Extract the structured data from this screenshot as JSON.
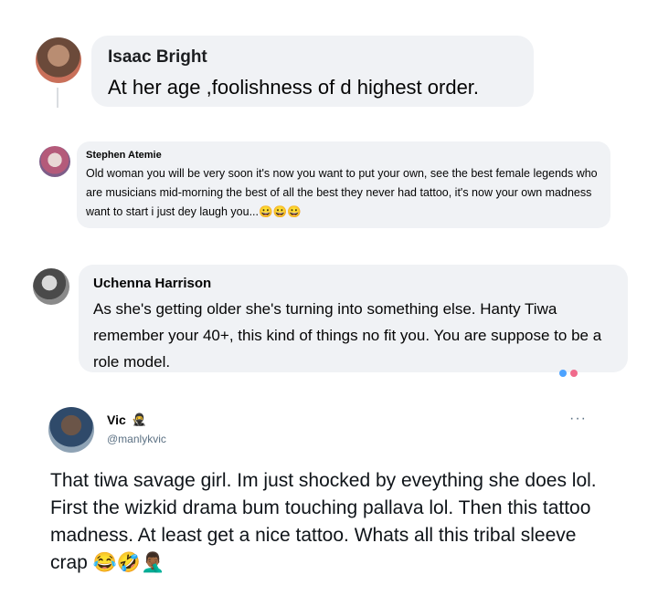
{
  "comments": [
    {
      "name": "Isaac Bright",
      "text": "At her age ,foolishness of d highest order."
    },
    {
      "name": "Stephen Atemie",
      "text": "Old woman you will be very soon it's now you want to put your own, see the best female legends who are musicians mid-morning the best of all the best they never had tattoo, it's now your own madness want to start i just dey laugh you...😀😀😀"
    },
    {
      "name": "Uchenna Harrison",
      "text": "As she's getting older she's turning into something else. Hanty Tiwa remember your 40+, this kind of things no fit you. You are suppose to be a role model."
    }
  ],
  "tweet": {
    "name": "Vic",
    "name_emoji": "🥷",
    "handle": "@manlykvic",
    "more": "···",
    "text": "That tiwa savage girl. Im just shocked by eveything she does lol. First the wizkid drama bum touching pallava lol. Then this tattoo madness. At least get a nice tattoo. Whats all this tribal sleeve crap 😂🤣🤦🏾‍♂️"
  },
  "colors": {
    "bubble": "#f0f2f5",
    "handle": "#5b7083"
  }
}
